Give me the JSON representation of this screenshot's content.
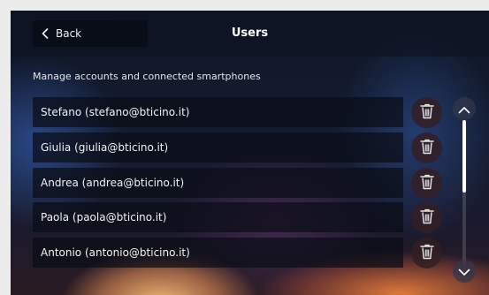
{
  "header": {
    "back_label": "Back",
    "title": "Users"
  },
  "subtitle": "Manage accounts and connected smartphones",
  "users": [
    {
      "label": "Stefano (stefano@bticino.it)"
    },
    {
      "label": "Giulia (giulia@bticino.it)"
    },
    {
      "label": "Andrea (andrea@bticino.it)"
    },
    {
      "label": "Paola (paola@bticino.it)"
    },
    {
      "label": "Antonio (antonio@bticino.it)"
    }
  ],
  "icons": {
    "back": "chevron-left-icon",
    "delete": "trash-icon",
    "scroll_up": "chevron-up-icon",
    "scroll_down": "chevron-down-icon"
  },
  "scroll": {
    "thumb_fraction": 0.5
  },
  "colors": {
    "text": "#ffffff",
    "row_background": "#0a0c16",
    "delete_button": "#321e23"
  }
}
